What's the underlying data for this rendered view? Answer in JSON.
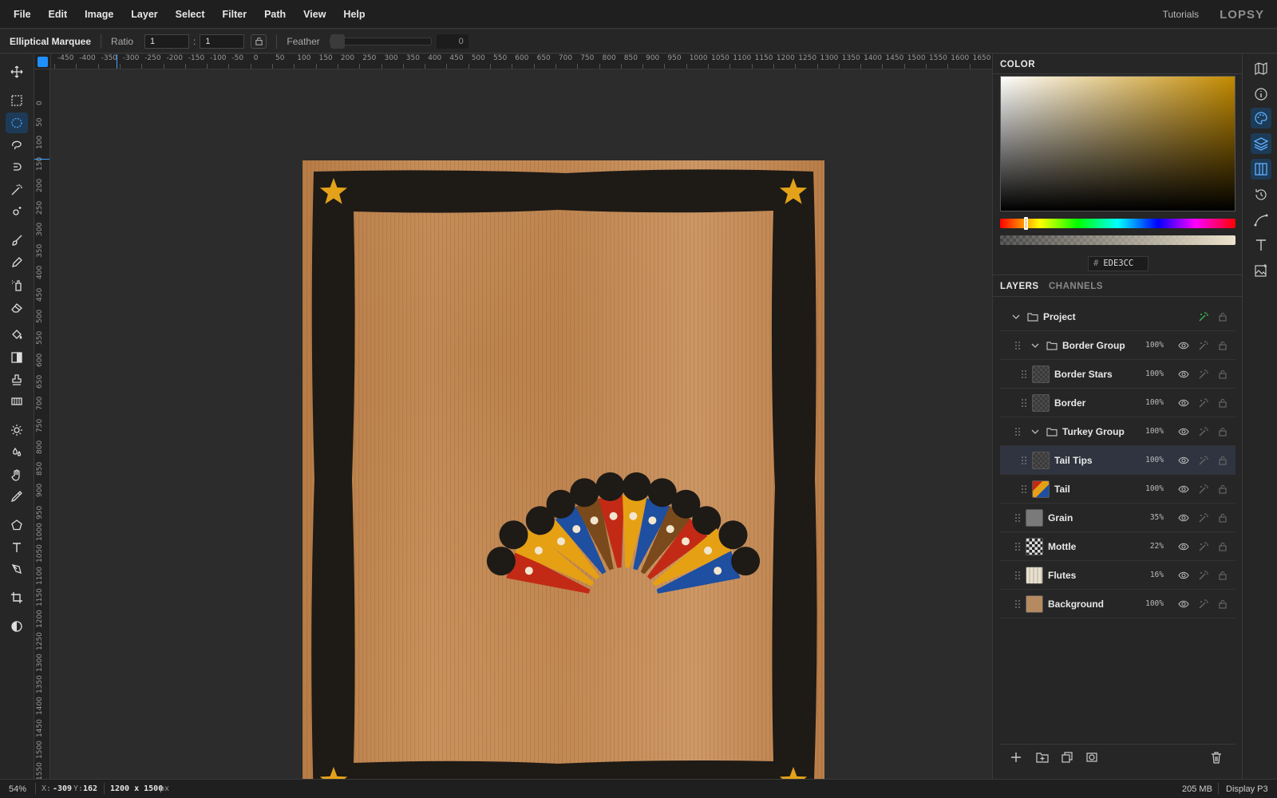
{
  "menubar": {
    "items": [
      "File",
      "Edit",
      "Image",
      "Layer",
      "Select",
      "Filter",
      "Path",
      "View",
      "Help"
    ],
    "tutorials": "Tutorials",
    "logo": "LOPSY"
  },
  "options": {
    "tool_name": "Elliptical Marquee",
    "ratio_label": "Ratio",
    "ratio_w": "1",
    "ratio_sep": ":",
    "ratio_h": "1",
    "feather_label": "Feather",
    "feather_value": "0"
  },
  "rulers": {
    "h": [
      "-450",
      "-400",
      "-350",
      "-300",
      "-250",
      "-200",
      "-150",
      "-100",
      "-50",
      "0",
      "50",
      "100",
      "150",
      "200",
      "250",
      "300",
      "350",
      "400",
      "450",
      "500",
      "550",
      "600",
      "650",
      "700",
      "750",
      "800",
      "850",
      "900",
      "950",
      "1000",
      "1050",
      "1100",
      "1150",
      "1200",
      "1250",
      "1300",
      "1350",
      "1400",
      "1450",
      "1500",
      "1550",
      "1600",
      "1650"
    ],
    "v": [
      "0",
      "50",
      "100",
      "150",
      "200",
      "250",
      "300",
      "350",
      "400",
      "450",
      "500",
      "550",
      "600",
      "650",
      "700",
      "750",
      "800",
      "850",
      "900",
      "950",
      "1000",
      "1050",
      "1100",
      "1150",
      "1200",
      "1250",
      "1300",
      "1350",
      "1400",
      "1450",
      "1500",
      "1550"
    ]
  },
  "color_panel": {
    "title": "COLOR",
    "hex": "EDE3CC",
    "hash": "#",
    "hue_fraction": 0.11,
    "color": "#ede3cc"
  },
  "layers_panel": {
    "tab_layers": "LAYERS",
    "tab_channels": "CHANNELS",
    "layers": [
      {
        "name": "Project",
        "indent": 0,
        "type": "group",
        "opacity": ""
      },
      {
        "name": "Border Group",
        "indent": 1,
        "type": "group",
        "opacity": "100%"
      },
      {
        "name": "Border Stars",
        "indent": 2,
        "type": "layer",
        "opacity": "100%"
      },
      {
        "name": "Border",
        "indent": 2,
        "type": "layer",
        "opacity": "100%"
      },
      {
        "name": "Turkey Group",
        "indent": 1,
        "type": "group",
        "opacity": "100%"
      },
      {
        "name": "Tail Tips",
        "indent": 2,
        "type": "layer",
        "opacity": "100%",
        "selected": true
      },
      {
        "name": "Tail",
        "indent": 2,
        "type": "layer",
        "opacity": "100%"
      },
      {
        "name": "Grain",
        "indent": 1,
        "type": "layer",
        "opacity": "35%"
      },
      {
        "name": "Mottle",
        "indent": 1,
        "type": "layer",
        "opacity": "22%"
      },
      {
        "name": "Flutes",
        "indent": 1,
        "type": "layer",
        "opacity": "16%"
      },
      {
        "name": "Background",
        "indent": 1,
        "type": "layer",
        "opacity": "100%"
      }
    ]
  },
  "status": {
    "zoom": "54%",
    "x_label": "X:",
    "x": "-309",
    "y_label": "Y:",
    "y": "162",
    "dims": "1200 x 1500",
    "unit": "px",
    "memory": "205 MB",
    "profile": "Display P3"
  },
  "colors": {
    "accent": "#1e90ff",
    "paper": "#c58f5b",
    "border": "#1e1a16",
    "star": "#e3a21a",
    "red": "#c22a16",
    "yellow": "#e6a014",
    "blue": "#1e4fa0",
    "brown": "#7a4a1c"
  }
}
